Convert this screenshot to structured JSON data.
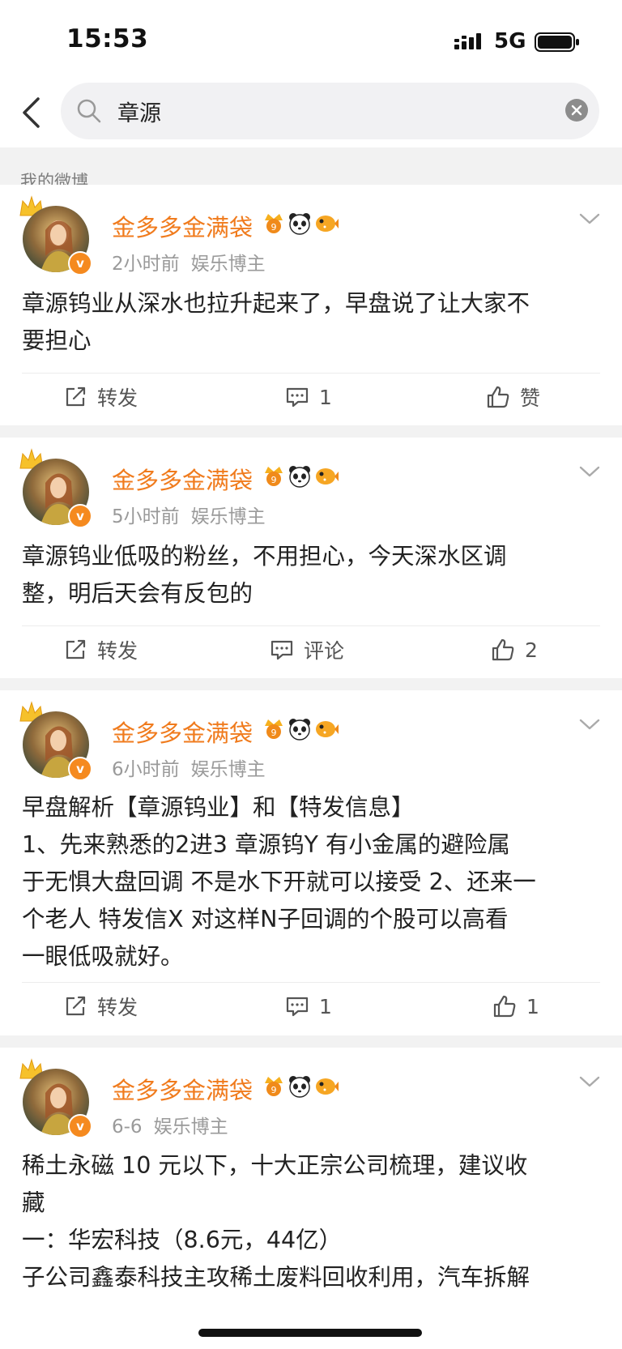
{
  "status_bar": {
    "time": "15:53",
    "network": "5G"
  },
  "search": {
    "query": "章源"
  },
  "section_label": "我的微博",
  "posts": [
    {
      "author": "金多多金满袋",
      "time": "2小时前",
      "category": "娱乐博主",
      "text": "章源钨业从深水也拉升起来了，早盘说了让大家不\n要担心",
      "repost_label": "转发",
      "comment_label": "1",
      "like_label": "赞"
    },
    {
      "author": "金多多金满袋",
      "time": "5小时前",
      "category": "娱乐博主",
      "text": "章源钨业低吸的粉丝，不用担心，今天深水区调\n整，明后天会有反包的",
      "repost_label": "转发",
      "comment_label": "评论",
      "like_label": "2"
    },
    {
      "author": "金多多金满袋",
      "time": "6小时前",
      "category": "娱乐博主",
      "text": "早盘解析【章源钨业】和【特发信息】\n1、先来熟悉的2进3 章源钨Y 有小金属的避险属\n于无惧大盘回调 不是水下开就可以接受 2、还来一\n个老人 特发信X 对这样N子回调的个股可以高看\n一眼低吸就好。",
      "repost_label": "转发",
      "comment_label": "1",
      "like_label": "1"
    },
    {
      "author": "金多多金满袋",
      "time": "6-6",
      "category": "娱乐博主",
      "text": "稀土永磁 10 元以下，十大正宗公司梳理，建议收\n藏\n一：华宏科技（8.6元，44亿）\n子公司鑫泰科技主攻稀土废料回收利用，汽车拆解",
      "repost_label": "",
      "comment_label": "",
      "like_label": ""
    }
  ]
}
